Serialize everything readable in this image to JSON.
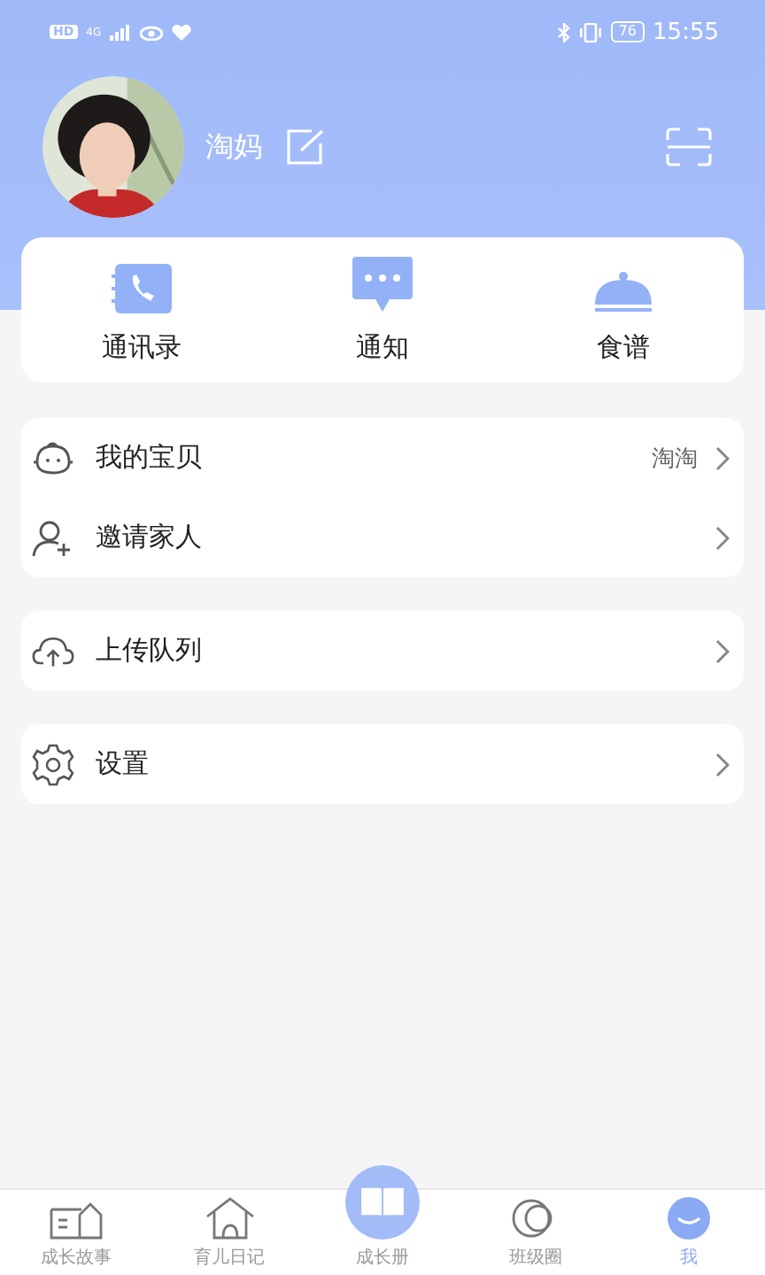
{
  "status_bar": {
    "left": [
      "HD",
      "4G"
    ],
    "battery": "76",
    "time": "15:55"
  },
  "profile": {
    "name": "淘妈"
  },
  "shortcuts": [
    {
      "label": "通讯录",
      "kind": "contacts"
    },
    {
      "label": "通知",
      "kind": "notice"
    },
    {
      "label": "食谱",
      "kind": "recipe"
    }
  ],
  "menu_groups": [
    [
      {
        "label": "我的宝贝",
        "value": "淘淘",
        "kind": "baby"
      },
      {
        "label": "邀请家人",
        "kind": "invite"
      }
    ],
    [
      {
        "label": "上传队列",
        "kind": "upload"
      }
    ],
    [
      {
        "label": "设置",
        "kind": "settings"
      }
    ]
  ],
  "tab_bar": [
    {
      "label": "成长故事",
      "kind": "story",
      "selected": false
    },
    {
      "label": "育儿日记",
      "kind": "diary",
      "selected": false
    },
    {
      "label": "成长册",
      "kind": "book",
      "selected": false
    },
    {
      "label": "班级圈",
      "kind": "circle",
      "selected": false
    },
    {
      "label": "我",
      "kind": "me",
      "selected": true
    }
  ]
}
